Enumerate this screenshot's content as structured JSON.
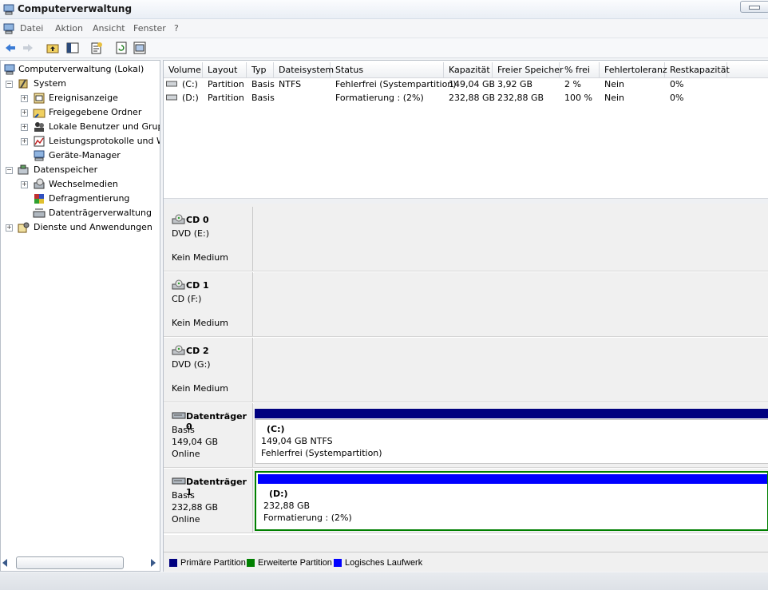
{
  "window": {
    "title": "Computerverwaltung"
  },
  "menu": [
    "Datei",
    "Aktion",
    "Ansicht",
    "Fenster",
    "?"
  ],
  "toolbar": {
    "icons": [
      "back-arrow-icon",
      "forward-arrow-icon",
      "up-folder-icon",
      "show-hide-tree-icon",
      "properties-icon",
      "refresh-icon",
      "help-icon"
    ]
  },
  "tree": {
    "root": "Computerverwaltung (Lokal)",
    "system": "System",
    "system_items": [
      "Ereignisanzeige",
      "Freigegebene Ordner",
      "Lokale Benutzer und Gruppe",
      "Leistungsprotokolle und War",
      "Geräte-Manager"
    ],
    "storage": "Datenspeicher",
    "storage_items": [
      "Wechselmedien",
      "Defragmentierung",
      "Datenträgerverwaltung"
    ],
    "services": "Dienste und Anwendungen"
  },
  "volumes": {
    "columns": [
      "Volume",
      "Layout",
      "Typ",
      "Dateisystem",
      "Status",
      "Kapazität",
      "Freier Speicher",
      "% frei",
      "Fehlertoleranz",
      "Restkapazität"
    ],
    "rows": [
      [
        "(C:)",
        "Partition",
        "Basis",
        "NTFS",
        "Fehlerfrei (Systempartition)",
        "149,04 GB",
        "3,92 GB",
        "2 %",
        "Nein",
        "0%"
      ],
      [
        "(D:)",
        "Partition",
        "Basis",
        "",
        "Formatierung : (2%)",
        "232,88 GB",
        "232,88 GB",
        "100 %",
        "Nein",
        "0%"
      ]
    ]
  },
  "disks": [
    {
      "name": "CD 0",
      "line1": "DVD (E:)",
      "line2": "",
      "line3": "Kein Medium"
    },
    {
      "name": "CD 1",
      "line1": "CD (F:)",
      "line2": "",
      "line3": "Kein Medium"
    },
    {
      "name": "CD 2",
      "line1": "DVD (G:)",
      "line2": "",
      "line3": "Kein Medium"
    },
    {
      "name": "Datenträger 0",
      "line1": "Basis",
      "line2": "149,04 GB",
      "line3": "Online",
      "partition": {
        "label": "(C:)",
        "size": "149,04 GB NTFS",
        "status": "Fehlerfrei (Systempartition)"
      }
    },
    {
      "name": "Datenträger 1",
      "line1": "Basis",
      "line2": "232,88 GB",
      "line3": "Online",
      "partition": {
        "label": "(D:)",
        "size": "232,88 GB",
        "status": "Formatierung : (2%)"
      }
    }
  ],
  "legend": [
    {
      "label": "Primäre Partition",
      "color": "#00007f"
    },
    {
      "label": "Erweiterte Partition",
      "color": "#008000"
    },
    {
      "label": "Logisches Laufwerk",
      "color": "#0000ff"
    }
  ],
  "colors": {
    "primary": "#00007f",
    "extended": "#008000",
    "logical": "#0000ff"
  }
}
